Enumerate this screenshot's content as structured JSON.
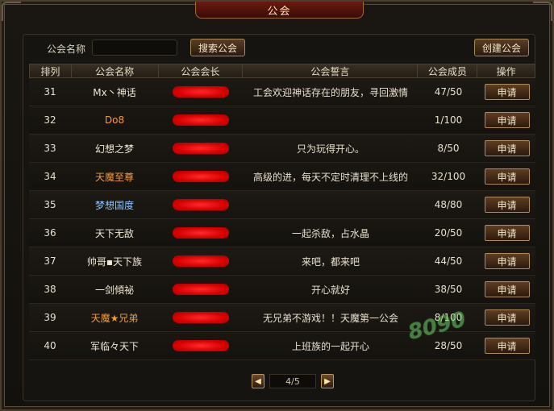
{
  "window": {
    "title": "公会"
  },
  "search": {
    "label": "公会名称",
    "value": "",
    "placeholder": "",
    "search_button": "搜索公会",
    "create_button": "创建公会"
  },
  "table": {
    "headers": [
      "排列",
      "公会名称",
      "公会会长",
      "公会誓言",
      "公会成员",
      "操作"
    ],
    "rows": [
      {
        "rank": "31",
        "name": "Mx丶神话",
        "name_color": "white",
        "oath": "工会欢迎神话存在的朋友，寻回激情",
        "members": "47/50",
        "action": "申请"
      },
      {
        "rank": "32",
        "name": "Do8",
        "name_color": "orange",
        "oath": "",
        "members": "1/100",
        "action": "申请"
      },
      {
        "rank": "33",
        "name": "幻想之梦",
        "name_color": "white",
        "oath": "只为玩得开心。",
        "members": "8/50",
        "action": "申请"
      },
      {
        "rank": "34",
        "name": "天魔至尊",
        "name_color": "orange",
        "oath": "高级的进，每天不定时清理不上线的",
        "members": "32/100",
        "action": "申请"
      },
      {
        "rank": "35",
        "name": "梦想国度",
        "name_color": "blue",
        "oath": "",
        "members": "48/80",
        "action": "申请"
      },
      {
        "rank": "36",
        "name": "天下无敌",
        "name_color": "white",
        "oath": "一起杀敌，占水晶",
        "members": "20/50",
        "action": "申请"
      },
      {
        "rank": "37",
        "name": "帅哥▪天下族",
        "name_color": "white",
        "oath": "来吧，都来吧",
        "members": "44/50",
        "action": "申请"
      },
      {
        "rank": "38",
        "name": "一剑傾祕",
        "name_color": "white",
        "oath": "开心就好",
        "members": "38/50",
        "action": "申请"
      },
      {
        "rank": "39",
        "name": "天魔★兄弟",
        "name_color": "orange",
        "oath": "无兄弟不游戏！！天魔第一公会",
        "members": "8/100",
        "action": "申请"
      },
      {
        "rank": "40",
        "name": "军临々天下",
        "name_color": "white",
        "oath": "上班族的一起开心",
        "members": "28/50",
        "action": "申请"
      }
    ]
  },
  "pager": {
    "prev_icon": "triangle-left-icon",
    "next_icon": "triangle-right-icon",
    "text": "4/5"
  },
  "colors": {
    "accent_red": "#d80000",
    "orange_name": "#f19a3a",
    "blue_name": "#8fc3ff",
    "button_border": "#b08b5b"
  }
}
